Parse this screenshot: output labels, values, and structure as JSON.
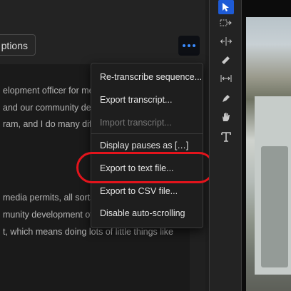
{
  "header": {
    "options_label": "ptions"
  },
  "transcript": {
    "lines": [
      "elopment officer for me",
      "and our community dev",
      "ram, and I do many diff",
      "",
      "",
      "media permits, all sorts",
      "munity development of",
      "t, which means doing lots of little things like"
    ]
  },
  "menu": {
    "items": [
      {
        "label": "Re-transcribe sequence...",
        "disabled": false
      },
      {
        "label": "Export transcript...",
        "disabled": false
      },
      {
        "label": "Import transcript...",
        "disabled": true
      },
      {
        "label": "Display pauses as […]",
        "disabled": false
      },
      {
        "label": "Export to text file...",
        "disabled": false
      },
      {
        "label": "Export to CSV file...",
        "disabled": false
      },
      {
        "label": "Disable auto-scrolling",
        "disabled": false
      }
    ]
  },
  "tools": [
    {
      "name": "selection-tool-icon",
      "glyph": "▲",
      "active": true
    },
    {
      "name": "track-select-tool-icon",
      "glyph": "⇥",
      "active": false
    },
    {
      "name": "ripple-edit-tool-icon",
      "glyph": "⇹",
      "active": false
    },
    {
      "name": "razor-tool-icon",
      "glyph": "✂",
      "active": false
    },
    {
      "name": "slip-tool-icon",
      "glyph": "↦",
      "active": false
    },
    {
      "name": "pen-tool-icon",
      "glyph": "✎",
      "active": false
    },
    {
      "name": "hand-tool-icon",
      "glyph": "✋",
      "active": false
    },
    {
      "name": "type-tool-icon",
      "glyph": "T",
      "active": false
    }
  ],
  "colors": {
    "accent": "#3b8cff",
    "highlight": "#e3141c"
  }
}
